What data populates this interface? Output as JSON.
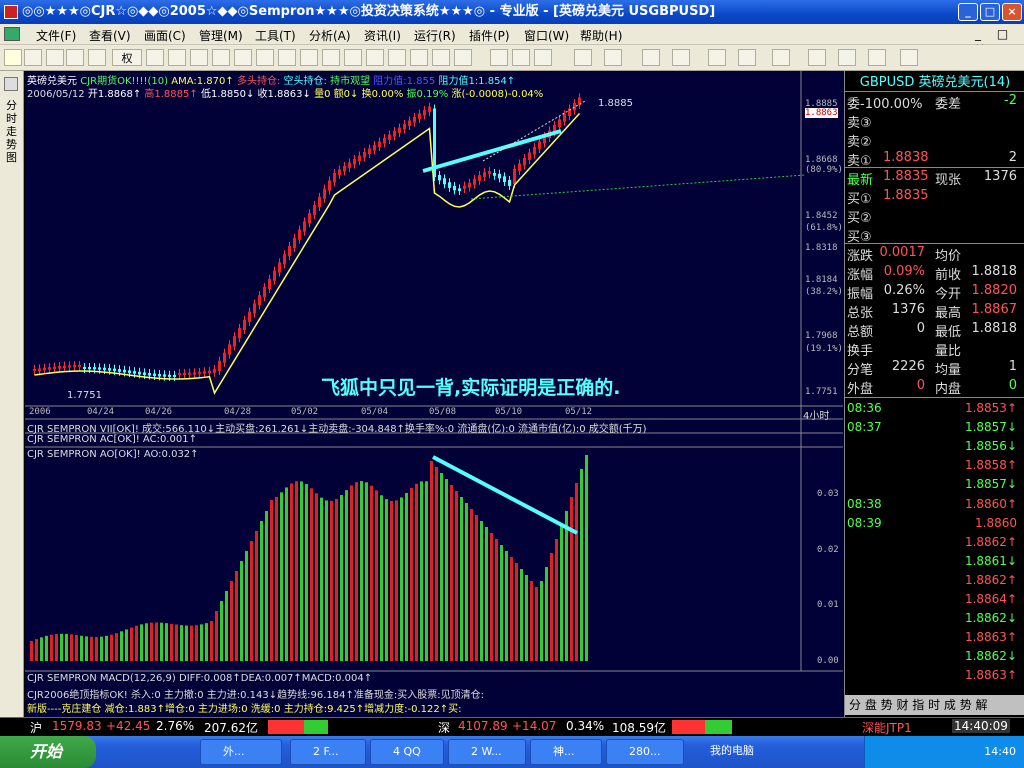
{
  "window": {
    "title": "◎◎★★★◎CJR☆◎◆◆◎2005☆◆◆◎Sempron★★★◎投资决策系统★★★◎ - 专业版 - [英磅兑美元 USGBPUSD]"
  },
  "menu": [
    "文件(F)",
    "查看(V)",
    "画面(C)",
    "管理(M)",
    "工具(T)",
    "分析(A)",
    "资讯(I)",
    "运行(R)",
    "插件(P)",
    "窗口(W)",
    "帮助(H)"
  ],
  "toolbar": {
    "weight_label": "权",
    "restore_down_label": "_ □ ×"
  },
  "sidebar": {
    "label": "分时走势图"
  },
  "chart": {
    "header1": {
      "name": "英磅兑美元",
      "cjr": "CJR期货OK!!!!(10)",
      "ama": "AMA:1.870↑",
      "long": "多头持仓:",
      "short": "空头持仓:",
      "watch": "持市观望",
      "support": "阻力值:1.855",
      "resist": "阻力值1:1.854↑"
    },
    "header2": {
      "date": "2006/05/12",
      "open": "开1.8868↑",
      "high": "高1.8885↑",
      "low": "低1.8850↓",
      "close": "收1.8863↓",
      "vol": "量0",
      "amount": "额0↓",
      "turnover": "换0.00%",
      "amplitude": "振0.19%",
      "change": "涨(-0.0008)-0.04%"
    },
    "annotation": "飞狐中只见一背,实际证明是正确的.",
    "price_labels": [
      {
        "v": "1.8885",
        "t": "high"
      },
      {
        "v": "1.8863",
        "t": "cur"
      },
      {
        "v": "1.8668",
        "t": ""
      },
      {
        "v": "(80.9%)",
        "t": ""
      },
      {
        "v": "1.8452",
        "t": ""
      },
      {
        "v": "(61.8%)",
        "t": ""
      },
      {
        "v": "1.8318",
        "t": ""
      },
      {
        "v": "1.8184",
        "t": ""
      },
      {
        "v": "(38.2%)",
        "t": ""
      },
      {
        "v": "1.7968",
        "t": ""
      },
      {
        "v": "(19.1%)",
        "t": ""
      },
      {
        "v": "1.7751",
        "t": ""
      }
    ],
    "low_label": "1.7751",
    "high_label": "1.8885",
    "dates": [
      "2006",
      "04/24",
      "04/26",
      "04/28",
      "05/02",
      "05/04",
      "05/08",
      "05/10",
      "05/12"
    ],
    "period": "4小时",
    "ind1": "CJR SEMPRON VII[OK]! 成交:566.110↓主动买盘:261.261↓主动卖盘:-304.848↑换手率%:0 流通盘(亿):0 流通市值(亿):0 成交额(千万)",
    "ind2": "CJR SEMPRON  AC[OK]! AC:0.001↑",
    "ind3": "CJR SEMPRON AO[OK]! AO:0.032↑",
    "ao_labels": [
      "0.03",
      "0.02",
      "0.01",
      "0.00"
    ],
    "macd": "CJR SEMPRON MACD(12,26,9) DIFF:0.008↑DEA:0.007↑MACD:0.004↑",
    "top": "CJR2006绝顶指标OK! 杀入:0 主力撤:0 主力进:0.143↓趋势线:96.184↑准备现金:买入股票:见顶清仓:",
    "newver": "新版----克庄建仓 减仓:1.883↑增仓:0 主力进场:0 洗缓:0 主力持仓:9.425↑增减力度:-0.122↑买:"
  },
  "quote": {
    "header": "GBPUSD 英磅兑美元(14)",
    "wb": "委-100.00%",
    "wc_label": "委差",
    "wc": "-2",
    "sell": [
      {
        "l": "卖③",
        "p": "",
        "v": ""
      },
      {
        "l": "卖②",
        "p": "",
        "v": ""
      },
      {
        "l": "卖①",
        "p": "1.8838",
        "v": "2"
      }
    ],
    "latest_label": "最新",
    "latest": "1.8835",
    "now_label": "现张",
    "now": "1376",
    "buy": [
      {
        "l": "买①",
        "p": "1.8835",
        "v": ""
      },
      {
        "l": "买②",
        "p": "",
        "v": ""
      },
      {
        "l": "买③",
        "p": "",
        "v": ""
      }
    ],
    "stats": [
      {
        "a": "涨跌",
        "av": "0.0017",
        "b": "均价",
        "bv": ""
      },
      {
        "a": "涨幅",
        "av": "0.09%",
        "b": "前收",
        "bv": "1.8818"
      },
      {
        "a": "振幅",
        "av": "0.26%",
        "b": "今开",
        "bv": "1.8820"
      },
      {
        "a": "总张",
        "av": "1376",
        "b": "最高",
        "bv": "1.8867"
      },
      {
        "a": "总额",
        "av": "0",
        "b": "最低",
        "bv": "1.8818"
      },
      {
        "a": "换手",
        "av": "",
        "b": "量比",
        "bv": ""
      },
      {
        "a": "分笔",
        "av": "2226",
        "b": "均量",
        "bv": "1"
      },
      {
        "a": "外盘",
        "av": "0",
        "b": "内盘",
        "bv": "0"
      }
    ],
    "ticks": [
      {
        "t": "08:36",
        "p": "1.8853↑"
      },
      {
        "t": "08:37",
        "p": "1.8857↓"
      },
      {
        "t": "",
        "p": "1.8856↓"
      },
      {
        "t": "",
        "p": "1.8858↑"
      },
      {
        "t": "",
        "p": "1.8857↓"
      },
      {
        "t": "08:38",
        "p": "1.8860↑"
      },
      {
        "t": "08:39",
        "p": "1.8860"
      },
      {
        "t": "",
        "p": "1.8862↑"
      },
      {
        "t": "",
        "p": "1.8861↓"
      },
      {
        "t": "",
        "p": "1.8862↑"
      },
      {
        "t": "",
        "p": "1.8864↑"
      },
      {
        "t": "",
        "p": "1.8862↓"
      },
      {
        "t": "",
        "p": "1.8863↑"
      },
      {
        "t": "",
        "p": "1.8862↓"
      },
      {
        "t": "",
        "p": "1.8863↑"
      }
    ],
    "tabs": "分 盘 势 财 指 时 成 势 解"
  },
  "status": {
    "sh_label": "沪",
    "sh": "1579.83",
    "sh_chg": "+42.45",
    "sh_pct": "2.76%",
    "sh_amt": "207.62亿",
    "sz_label": "深",
    "sz": "4107.89",
    "sz_chg": "+14.07",
    "sz_pct": "0.34%",
    "sz_amt": "108.59亿",
    "mod": "深能JTP1",
    "time": "14:40:09"
  },
  "taskbar": {
    "start": "开始",
    "items": [
      "外...",
      "2 F...",
      "4 QQ",
      "2 W...",
      "神...",
      "280...",
      "我的电脑"
    ],
    "clock": "14:40"
  }
}
